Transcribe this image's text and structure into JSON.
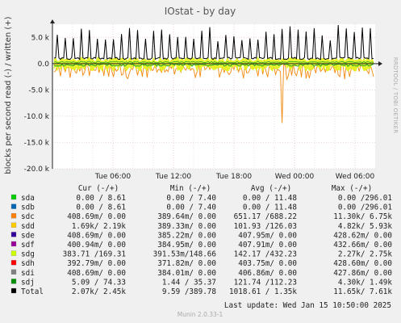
{
  "chart_data": {
    "type": "line",
    "title": "IOstat - by day",
    "ylabel": "blocks per second read (-) / written (+)",
    "side_label": "RRDTOOL / TOBI OETIKER",
    "ylim": [
      -20000,
      7500
    ],
    "y_ticks": [
      5000,
      0,
      -5000,
      -10000,
      -15000,
      -20000
    ],
    "y_tick_labels": [
      "5.0 k",
      "0.0",
      "-5.0 k",
      "-10.0 k",
      "-15.0 k",
      "-20.0 k"
    ],
    "x_range_hours": [
      0,
      32
    ],
    "x_ticks": [
      {
        "label": "Tue 06:00",
        "hour": 6
      },
      {
        "label": "Tue 12:00",
        "hour": 12
      },
      {
        "label": "Tue 18:00",
        "hour": 18
      },
      {
        "label": "Wed 00:00",
        "hour": 24
      },
      {
        "label": "Wed 06:00",
        "hour": 30
      }
    ],
    "series_colors": {
      "sdc": "#f2880d",
      "sdg": "#e3f21b",
      "sdj": "#1fa01f",
      "Total": "#000000"
    },
    "series_profile": {
      "sdc_read_spike_min": -11300,
      "sdc_read_typical_min": -3000,
      "sdg_read_typical_min": -1500,
      "sdj_read_typical_min": -500,
      "total_write_peak": 7610,
      "total_write_base": 800
    },
    "legend_headers": [
      "Cur (-/+)",
      "Min (-/+)",
      "Avg (-/+)",
      "Max (-/+)"
    ],
    "legend": [
      {
        "name": "sda",
        "color": "#00cc00",
        "cur": "0.00 / 8.61",
        "min": "0.00 / 7.40",
        "avg": "0.00 / 11.48",
        "max": "0.00 /296.01"
      },
      {
        "name": "sdb",
        "color": "#0066b3",
        "cur": "0.00 / 8.61",
        "min": "0.00 / 7.40",
        "avg": "0.00 / 11.48",
        "max": "0.00 /296.01"
      },
      {
        "name": "sdc",
        "color": "#ff8000",
        "cur": "408.69m/ 0.00",
        "min": "389.64m/ 0.00",
        "avg": "651.17 /688.22",
        "max": "11.30k/ 6.75k"
      },
      {
        "name": "sdd",
        "color": "#ffcc00",
        "cur": "1.69k/ 2.19k",
        "min": "389.33m/ 0.00",
        "avg": "101.93 /126.03",
        "max": "4.82k/ 5.93k"
      },
      {
        "name": "sde",
        "color": "#330099",
        "cur": "408.69m/ 0.00",
        "min": "385.22m/ 0.00",
        "avg": "407.95m/ 0.00",
        "max": "428.62m/ 0.00"
      },
      {
        "name": "sdf",
        "color": "#990099",
        "cur": "400.94m/ 0.00",
        "min": "384.95m/ 0.00",
        "avg": "407.91m/ 0.00",
        "max": "432.66m/ 0.00"
      },
      {
        "name": "sdg",
        "color": "#ccff00",
        "cur": "383.71 /169.31",
        "min": "391.53m/148.66",
        "avg": "142.17 /432.23",
        "max": "2.27k/ 2.75k"
      },
      {
        "name": "sdh",
        "color": "#ff0000",
        "cur": "392.79m/ 0.00",
        "min": "371.82m/ 0.00",
        "avg": "403.75m/ 0.00",
        "max": "428.60m/ 0.00"
      },
      {
        "name": "sdi",
        "color": "#808080",
        "cur": "408.69m/ 0.00",
        "min": "384.01m/ 0.00",
        "avg": "406.86m/ 0.00",
        "max": "427.86m/ 0.00"
      },
      {
        "name": "sdj",
        "color": "#008f00",
        "cur": "5.09 / 74.33",
        "min": "1.44 / 35.37",
        "avg": "121.74 /112.23",
        "max": "4.30k/ 1.49k"
      },
      {
        "name": "Total",
        "color": "#000000",
        "cur": "2.07k/ 2.45k",
        "min": "9.59 /389.78",
        "avg": "1018.61 / 1.35k",
        "max": "11.65k/ 7.61k"
      }
    ],
    "last_update": "Last update:  Wed Jan 15 10:50:00 2025",
    "footer": "Munin 2.0.33-1"
  }
}
